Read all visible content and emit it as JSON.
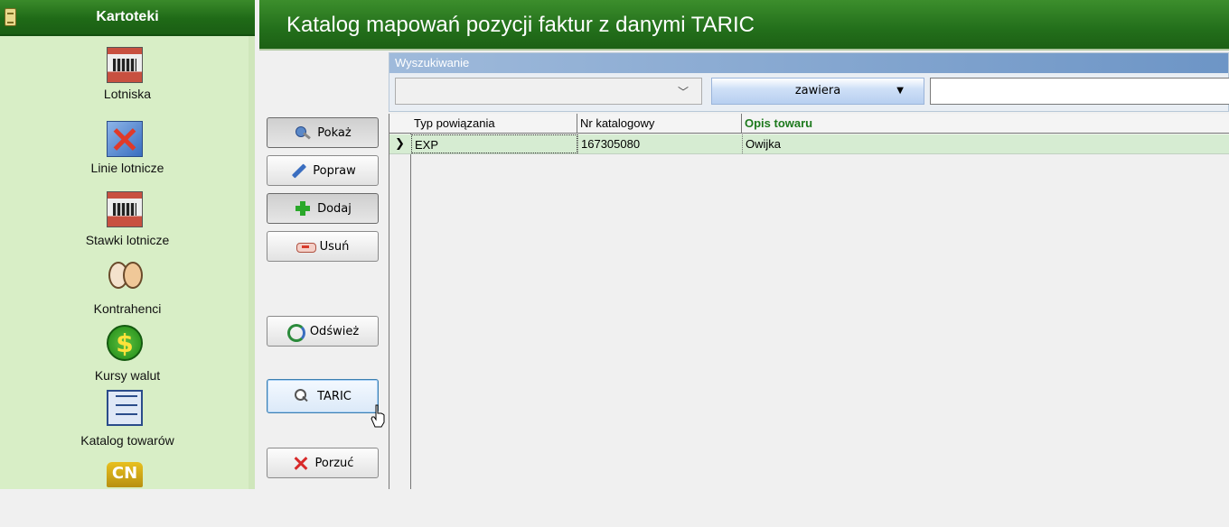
{
  "sidebar": {
    "title": "Kartoteki",
    "items": [
      {
        "label": "Lotniska",
        "icon": "airport-icon"
      },
      {
        "label": "Linie lotnicze",
        "icon": "airlines-icon"
      },
      {
        "label": "Stawki lotnicze",
        "icon": "airport-rates-icon"
      },
      {
        "label": "Kontrahenci",
        "icon": "contractors-icon"
      },
      {
        "label": "Kursy walut",
        "icon": "currency-icon"
      },
      {
        "label": "Katalog towarów",
        "icon": "goods-catalog-icon"
      },
      {
        "label": "",
        "icon": "cn-codes-icon"
      }
    ]
  },
  "header": {
    "title": "Katalog mapowań pozycji faktur z danymi TARIC"
  },
  "toolbar": {
    "show": "Pokaż",
    "edit": "Popraw",
    "add": "Dodaj",
    "delete": "Usuń",
    "refresh": "Odśwież",
    "taric": "TARIC",
    "cancel": "Porzuć"
  },
  "search": {
    "title": "Wyszukiwanie",
    "field_value": "",
    "mode": "zawiera",
    "query": ""
  },
  "grid": {
    "columns": [
      "Typ powiązania",
      "Nr katalogowy",
      "Opis towaru"
    ],
    "sorted_column": "Opis towaru",
    "rows": [
      {
        "type": "EXP",
        "catalog_no": "167305080",
        "description": "Owijka"
      }
    ]
  },
  "colors": {
    "header_green": "#236f1b",
    "sidebar_bg": "#d8eec6",
    "selected_row": "#d6ecd2",
    "sorted_header": "#1e7a1e"
  }
}
